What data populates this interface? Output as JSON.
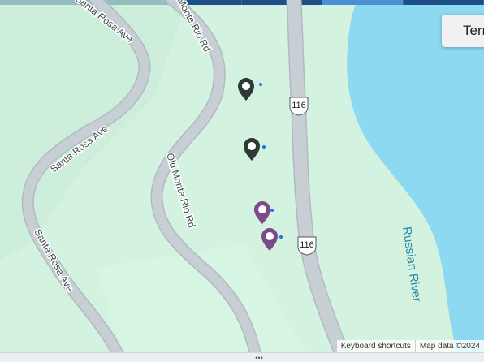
{
  "map": {
    "roads": [
      {
        "name": "Santa Rosa Ave",
        "kind": "local"
      },
      {
        "name": "Old Monte Rio Rd",
        "kind": "local"
      },
      {
        "name": "116",
        "kind": "state-highway"
      }
    ],
    "labels": {
      "santa_rosa_ave_top": "Santa Rosa Ave",
      "santa_rosa_ave_mid": "Santa Rosa Ave",
      "santa_rosa_ave_low": "Santa Rosa Ave",
      "monte_rio_rd_top": "Monte Rio Rd",
      "old_monte_rio_rd": "Old Monte Rio Rd",
      "highway_shield_top": "116",
      "highway_shield_bottom": "116",
      "river": "Russian River"
    },
    "markers": [
      {
        "name": "map-marker-1",
        "color": "#2f3a36"
      },
      {
        "name": "map-marker-2",
        "color": "#2f3a36"
      },
      {
        "name": "map-marker-3",
        "color": "#7b4a8a"
      },
      {
        "name": "map-marker-4",
        "color": "#7b4a8a"
      }
    ],
    "colors": {
      "land": "#d3f2df",
      "road": "#c7ced4",
      "road_outline": "#b2bac1",
      "water": "#8ed9f2",
      "water_label": "#2b8aa8",
      "label": "#3a4a4a"
    }
  },
  "controls": {
    "terrain_button": "Terrain"
  },
  "attribution": {
    "keyboard_shortcuts": "Keyboard shortcuts",
    "map_data": "Map data ©2024"
  }
}
